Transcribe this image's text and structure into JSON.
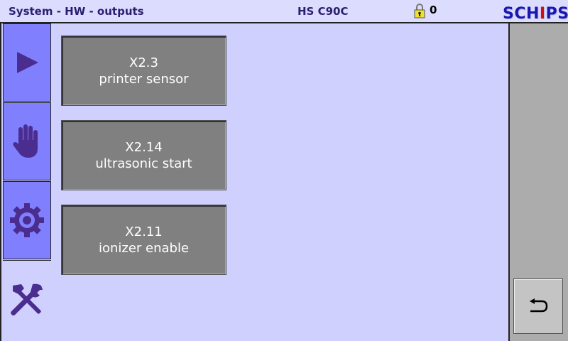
{
  "header": {
    "title": "System - HW - outputs",
    "machine": "HS C90C",
    "lock_count": "0",
    "logo": {
      "text_main": "SCH",
      "text_i": "I",
      "text_end": "PS"
    }
  },
  "sidebar": {
    "items": [
      {
        "icon": "play-icon",
        "active": false
      },
      {
        "icon": "hand-icon",
        "active": false
      },
      {
        "icon": "gear-icon",
        "active": false
      },
      {
        "icon": "tools-icon",
        "active": true
      }
    ]
  },
  "outputs": [
    {
      "id": "X2.3",
      "label": "printer sensor"
    },
    {
      "id": "X2.14",
      "label": "ultrasonic start"
    },
    {
      "id": "X2.11",
      "label": "ionizer enable"
    }
  ],
  "back_button": {
    "icon": "return-arrow-icon"
  },
  "colors": {
    "background": "#d0d0ff",
    "nav_button": "#8080ff",
    "output_button": "#808080",
    "icon": "#4b2d8f"
  }
}
